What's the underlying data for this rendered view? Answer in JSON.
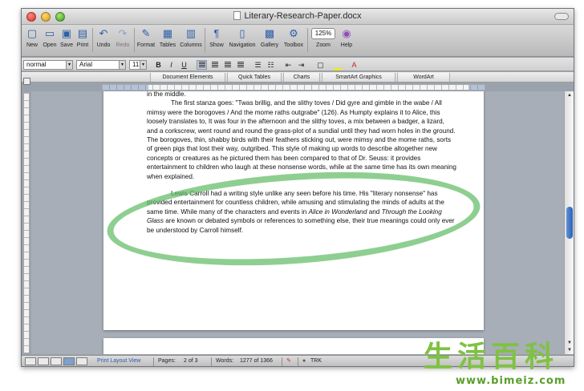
{
  "window": {
    "title": "Literary-Research-Paper.docx"
  },
  "toolbar": {
    "items": [
      {
        "label": "New",
        "icon": "new-doc-icon"
      },
      {
        "label": "Open",
        "icon": "folder-icon"
      },
      {
        "label": "Save",
        "icon": "save-icon"
      },
      {
        "label": "Print",
        "icon": "print-icon"
      },
      {
        "label": "Undo",
        "icon": "undo-icon"
      },
      {
        "label": "Redo",
        "icon": "redo-icon"
      },
      {
        "label": "Format",
        "icon": "brush-icon"
      },
      {
        "label": "Tables",
        "icon": "table-icon"
      },
      {
        "label": "Columns",
        "icon": "columns-icon"
      },
      {
        "label": "Show",
        "icon": "pilcrow-icon"
      },
      {
        "label": "Navigation",
        "icon": "navigation-icon"
      },
      {
        "label": "Gallery",
        "icon": "gallery-icon"
      },
      {
        "label": "Toolbox",
        "icon": "toolbox-icon"
      },
      {
        "label": "Zoom",
        "value": "125%"
      },
      {
        "label": "Help",
        "icon": "help-icon"
      }
    ]
  },
  "format_bar": {
    "style": "normal",
    "font": "Arial",
    "size": "11",
    "bold": "B",
    "italic": "I",
    "underline": "U",
    "font_color_glyph": "A"
  },
  "ribbon": {
    "tabs": [
      "Document Elements",
      "Quick Tables",
      "Charts",
      "SmartArt Graphics",
      "WordArt"
    ]
  },
  "ruler": {
    "labels": [
      "2",
      "1",
      "1",
      "2",
      "3",
      "4",
      "5",
      "6",
      "7",
      "8",
      "9",
      "10",
      "11",
      "12",
      "13",
      "14",
      "15",
      "16",
      "17",
      "18",
      "19"
    ]
  },
  "document": {
    "para0": "in the middle.",
    "para1": "The first stanza goes: \"Twas brillig, and the slithy toves / Did gyre and gimble in the wabe / All mimsy were the borogoves / And the mome raths outgrabe\" (126). As Humpty explains it to Alice, this loosely translates to, It was four in the afternoon and the slithy toves, a mix between a badger, a lizard, and a corkscrew, went round and round the grass-plot of a sundial until they had worn holes in the ground. The borogoves, thin, shabby birds with their feathers sticking out, were mimsy and the mome raths, sorts of green pigs that lost their way, outgribed. This style of making up words to describe altogether new concepts or creatures as he pictured them has been compared to that of Dr. Seuss: it provides entertainment to children who laugh at these nonsense words, while at the same time has its own meaning when explained.",
    "para2_a": "Lewis Carroll had a writing style unlike any seen before his time. His \"literary nonsense\" has provided entertainment for countless children, while amusing and stimulating the minds of adults at the same time. While many of the characters and events in ",
    "para2_b": "Alice in Wonderland",
    "para2_c": " and ",
    "para2_d": "Through the Looking Glass",
    "para2_e": " are known or debated symbols or references to something else, their true meanings could only ever be understood by Carroll himself."
  },
  "status": {
    "view": "Print Layout View",
    "pages_label": "Pages:",
    "pages_value": "2 of 3",
    "words_label": "Words:",
    "words_value": "1277 of 1366",
    "trk": "TRK"
  },
  "watermark": {
    "chars": "生活百科",
    "url": "www.bimeiz.com"
  },
  "colors": {
    "highlight": "#62bc66",
    "accent": "#2c5fb6",
    "watermark": "#7fc242"
  }
}
